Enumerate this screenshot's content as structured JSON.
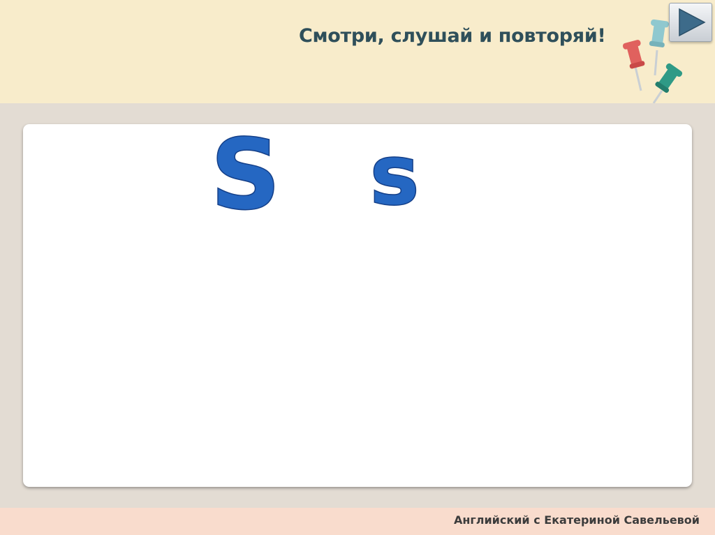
{
  "header": {
    "title": "Смотри, слушай и повторяй!",
    "decoration_icon": "push-pins-icon",
    "play_button_icon": "play-triangle-icon"
  },
  "card": {
    "uppercase_letter": "S",
    "lowercase_letter": "s",
    "letter_color": "#2567c2"
  },
  "footer": {
    "credit": "Английский с Екатериной Савельевой"
  },
  "colors": {
    "header_bg": "#f8eccb",
    "page_bg": "#e3dcd3",
    "footer_bg": "#f9dccd",
    "title_color": "#2f4f5a"
  }
}
